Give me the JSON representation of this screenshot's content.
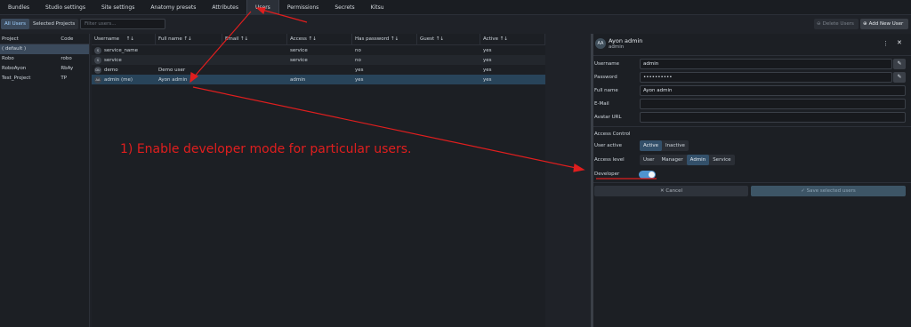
{
  "nav": {
    "tabs": [
      "Bundles",
      "Studio settings",
      "Site settings",
      "Anatomy presets",
      "Attributes",
      "Users",
      "Permissions",
      "Secrets",
      "Kitsu"
    ],
    "active": "Users"
  },
  "toolbar": {
    "all_users": "All Users",
    "selected_projects": "Selected Projects",
    "filter_placeholder": "Filter users...",
    "delete_users": "Delete Users",
    "add_new_user": "Add New User"
  },
  "projects": {
    "col_project": "Project",
    "col_code": "Code",
    "rows": [
      {
        "name": "( default )",
        "code": ""
      },
      {
        "name": "Robo",
        "code": "robo"
      },
      {
        "name": "RoboAyon",
        "code": "RbAy"
      },
      {
        "name": "Test_Project",
        "code": "TP"
      }
    ]
  },
  "users": {
    "columns": [
      "Username",
      "Full name",
      "Email",
      "Access",
      "Has password",
      "Guest",
      "Active"
    ],
    "rows": [
      {
        "avatar": "S",
        "username": "service_name",
        "fullname": "",
        "email": "",
        "access": "service",
        "has_password": "no",
        "guest": "",
        "active": "yes"
      },
      {
        "avatar": "S",
        "username": "service",
        "fullname": "",
        "email": "",
        "access": "service",
        "has_password": "no",
        "guest": "",
        "active": "yes"
      },
      {
        "avatar": "DU",
        "username": "demo",
        "fullname": "Demo user",
        "email": "",
        "access": "",
        "has_password": "yes",
        "guest": "",
        "active": "yes"
      },
      {
        "avatar": "AA",
        "username": "admin (me)",
        "fullname": "Ayon admin",
        "email": "",
        "access": "admin",
        "has_password": "yes",
        "guest": "",
        "active": "yes"
      }
    ]
  },
  "detail": {
    "avatar": "AA",
    "name": "Ayon admin",
    "sub": "admin",
    "labels": {
      "username": "Username",
      "password": "Password",
      "fullname": "Full name",
      "email": "E-Mail",
      "avatar_url": "Avatar URL",
      "access_control": "Access Control",
      "user_active": "User active",
      "access_level": "Access level",
      "developer": "Developer"
    },
    "values": {
      "username": "admin",
      "password": "••••••••••",
      "fullname": "Ayon admin",
      "email": "",
      "avatar_url": ""
    },
    "active_options": [
      "Active",
      "Inactive"
    ],
    "active_selected": "Active",
    "access_options": [
      "User",
      "Manager",
      "Admin",
      "Service"
    ],
    "access_selected": "Admin",
    "developer_on": true,
    "cancel": "Cancel",
    "save": "Save selected users"
  },
  "annotation": {
    "text": "1) Enable developer mode for particular users.",
    "color": "#e01e1e"
  }
}
